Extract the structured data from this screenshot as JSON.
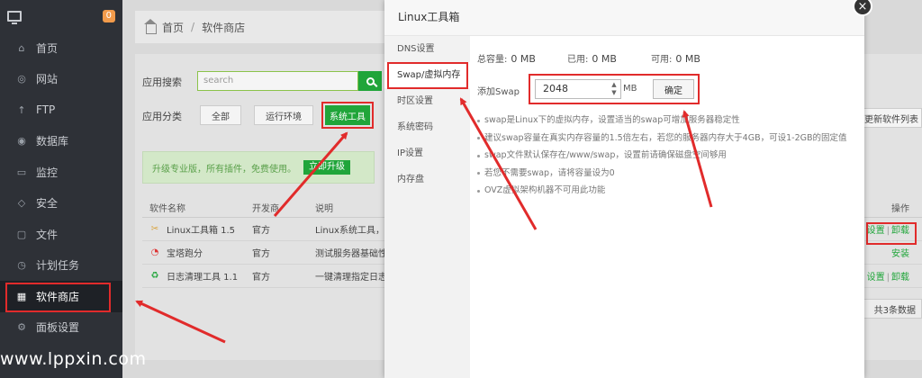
{
  "sidebar": {
    "badge": "0",
    "items": [
      {
        "label": "首页",
        "icon": "home-icon"
      },
      {
        "label": "网站",
        "icon": "globe-icon"
      },
      {
        "label": "FTP",
        "icon": "ftp-icon"
      },
      {
        "label": "数据库",
        "icon": "database-icon"
      },
      {
        "label": "监控",
        "icon": "monitor-icon"
      },
      {
        "label": "安全",
        "icon": "shield-icon"
      },
      {
        "label": "文件",
        "icon": "folder-icon"
      },
      {
        "label": "计划任务",
        "icon": "clock-icon"
      },
      {
        "label": "软件商店",
        "icon": "grid-icon"
      },
      {
        "label": "面板设置",
        "icon": "gear-icon"
      }
    ]
  },
  "breadcrumb": {
    "home": "首页",
    "sep": "/",
    "current": "软件商店"
  },
  "store": {
    "search_label": "应用搜索",
    "search_placeholder": "search",
    "category_label": "应用分类",
    "categories": [
      "全部",
      "运行环境",
      "系统工具"
    ],
    "promo_text": "升级专业版，所有插件，免费使用。",
    "promo_button": "立即升级",
    "update_button": "更新软件列表"
  },
  "table": {
    "headers": [
      "软件名称",
      "开发商",
      "说明",
      "操作"
    ],
    "rows": [
      {
        "name": "Linux工具箱 1.5",
        "vendor": "官方",
        "desc": "Linux系统工具，",
        "op1": "设置",
        "op_sep": "|",
        "op2": "卸载"
      },
      {
        "name": "宝塔跑分",
        "vendor": "官方",
        "desc": "测试服务器基础性",
        "op1": "安装",
        "op_sep": "",
        "op2": ""
      },
      {
        "name": "日志清理工具 1.1",
        "vendor": "官方",
        "desc": "一键清理指定日志",
        "op1": "设置",
        "op_sep": "|",
        "op2": "卸载"
      }
    ],
    "pager": "共3条数据"
  },
  "modal": {
    "title": "Linux工具箱",
    "close": "×",
    "nav": [
      "DNS设置",
      "Swap/虚拟内存",
      "时区设置",
      "系统密码",
      "IP设置",
      "内存盘"
    ],
    "total_label": "总容量:",
    "total_value": "0 MB",
    "used_label": "已用:",
    "used_value": "0 MB",
    "free_label": "可用:",
    "free_value": "0 MB",
    "add_label": "添加Swap",
    "swap_value": "2048",
    "unit": "MB",
    "confirm": "确定",
    "tips": [
      "swap是Linux下的虚拟内存，设置适当的swap可增加服务器稳定性",
      "建议swap容量在真实内存容量的1.5倍左右，若您的服务器内存大于4GB，可设1-2GB的固定值",
      "swap文件默认保存在/www/swap，设置前请确保磁盘空间够用",
      "若您不需要swap，请将容量设为0",
      "OVZ虚拟架构机器不可用此功能"
    ]
  },
  "watermark": "www.lppxin.com",
  "colors": {
    "accent": "#20a53a",
    "highlight": "#e12b2b",
    "sidebar": "#2e3137"
  }
}
